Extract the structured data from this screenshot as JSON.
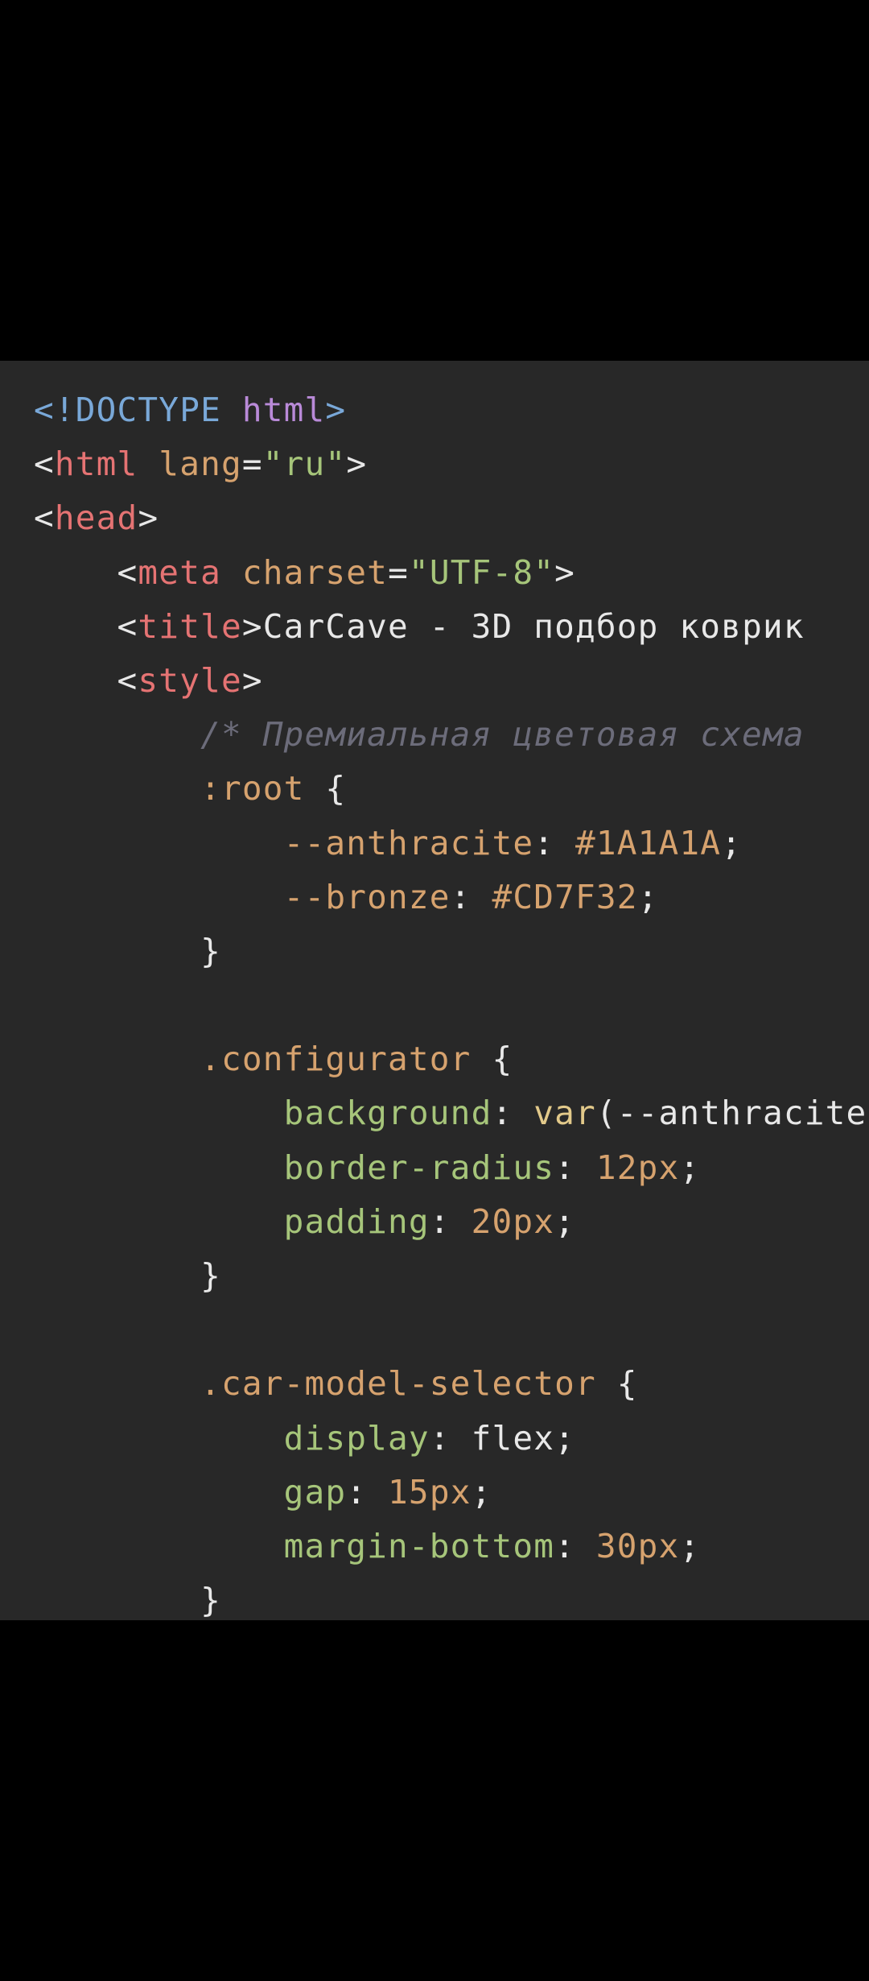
{
  "colors": {
    "background": "#000000",
    "panel": "#282828",
    "plain": "#e8e8e8",
    "doctype": "#79a8d8",
    "doctype_keyword": "#b98ad8",
    "tag": "#e57373",
    "attribute": "#d6a26e",
    "string": "#a6c57a",
    "comment": "#6c6c7a",
    "selector": "#d6a26e",
    "variable": "#d6a26e",
    "property": "#a6c57a",
    "number": "#d6a26e",
    "function": "#e2c98a"
  },
  "lines": [
    [
      {
        "t": "<!DOCTYPE ",
        "c": "doctype"
      },
      {
        "t": "html",
        "c": "doctype_keyword"
      },
      {
        "t": ">",
        "c": "doctype"
      }
    ],
    [
      {
        "t": "<",
        "c": "plain"
      },
      {
        "t": "html",
        "c": "tag"
      },
      {
        "t": " ",
        "c": "plain"
      },
      {
        "t": "lang",
        "c": "attribute"
      },
      {
        "t": "=",
        "c": "plain"
      },
      {
        "t": "\"ru\"",
        "c": "string"
      },
      {
        "t": ">",
        "c": "plain"
      }
    ],
    [
      {
        "t": "<",
        "c": "plain"
      },
      {
        "t": "head",
        "c": "tag"
      },
      {
        "t": ">",
        "c": "plain"
      }
    ],
    [
      {
        "t": "    <",
        "c": "plain"
      },
      {
        "t": "meta",
        "c": "tag"
      },
      {
        "t": " ",
        "c": "plain"
      },
      {
        "t": "charset",
        "c": "attribute"
      },
      {
        "t": "=",
        "c": "plain"
      },
      {
        "t": "\"UTF-8\"",
        "c": "string"
      },
      {
        "t": ">",
        "c": "plain"
      }
    ],
    [
      {
        "t": "    <",
        "c": "plain"
      },
      {
        "t": "title",
        "c": "tag"
      },
      {
        "t": ">",
        "c": "plain"
      },
      {
        "t": "CarCave - 3D подбор коврик",
        "c": "plain"
      }
    ],
    [
      {
        "t": "    <",
        "c": "plain"
      },
      {
        "t": "style",
        "c": "tag"
      },
      {
        "t": ">",
        "c": "plain"
      }
    ],
    [
      {
        "t": "        /* Премиальная цветовая схема",
        "c": "comment",
        "i": true
      }
    ],
    [
      {
        "t": "        ",
        "c": "plain"
      },
      {
        "t": ":root",
        "c": "selector"
      },
      {
        "t": " {",
        "c": "plain"
      }
    ],
    [
      {
        "t": "            ",
        "c": "plain"
      },
      {
        "t": "--anthracite",
        "c": "variable"
      },
      {
        "t": ": ",
        "c": "plain"
      },
      {
        "t": "#1A1A1A",
        "c": "number"
      },
      {
        "t": ";",
        "c": "plain"
      }
    ],
    [
      {
        "t": "            ",
        "c": "plain"
      },
      {
        "t": "--bronze",
        "c": "variable"
      },
      {
        "t": ": ",
        "c": "plain"
      },
      {
        "t": "#CD7F32",
        "c": "number"
      },
      {
        "t": ";",
        "c": "plain"
      }
    ],
    [
      {
        "t": "        }",
        "c": "plain"
      }
    ],
    [],
    [
      {
        "t": "        ",
        "c": "plain"
      },
      {
        "t": ".configurator",
        "c": "selector"
      },
      {
        "t": " {",
        "c": "plain"
      }
    ],
    [
      {
        "t": "            ",
        "c": "plain"
      },
      {
        "t": "background",
        "c": "property"
      },
      {
        "t": ": ",
        "c": "plain"
      },
      {
        "t": "var",
        "c": "function"
      },
      {
        "t": "(--anthracite",
        "c": "plain"
      }
    ],
    [
      {
        "t": "            ",
        "c": "plain"
      },
      {
        "t": "border-radius",
        "c": "property"
      },
      {
        "t": ": ",
        "c": "plain"
      },
      {
        "t": "12px",
        "c": "number"
      },
      {
        "t": ";",
        "c": "plain"
      }
    ],
    [
      {
        "t": "            ",
        "c": "plain"
      },
      {
        "t": "padding",
        "c": "property"
      },
      {
        "t": ": ",
        "c": "plain"
      },
      {
        "t": "20px",
        "c": "number"
      },
      {
        "t": ";",
        "c": "plain"
      }
    ],
    [
      {
        "t": "        }",
        "c": "plain"
      }
    ],
    [],
    [
      {
        "t": "        ",
        "c": "plain"
      },
      {
        "t": ".car-model-selector",
        "c": "selector"
      },
      {
        "t": " {",
        "c": "plain"
      }
    ],
    [
      {
        "t": "            ",
        "c": "plain"
      },
      {
        "t": "display",
        "c": "property"
      },
      {
        "t": ": ",
        "c": "plain"
      },
      {
        "t": "flex",
        "c": "plain"
      },
      {
        "t": ";",
        "c": "plain"
      }
    ],
    [
      {
        "t": "            ",
        "c": "plain"
      },
      {
        "t": "gap",
        "c": "property"
      },
      {
        "t": ": ",
        "c": "plain"
      },
      {
        "t": "15px",
        "c": "number"
      },
      {
        "t": ";",
        "c": "plain"
      }
    ],
    [
      {
        "t": "            ",
        "c": "plain"
      },
      {
        "t": "margin-bottom",
        "c": "property"
      },
      {
        "t": ": ",
        "c": "plain"
      },
      {
        "t": "30px",
        "c": "number"
      },
      {
        "t": ";",
        "c": "plain"
      }
    ],
    [
      {
        "t": "        }",
        "c": "plain"
      }
    ]
  ]
}
